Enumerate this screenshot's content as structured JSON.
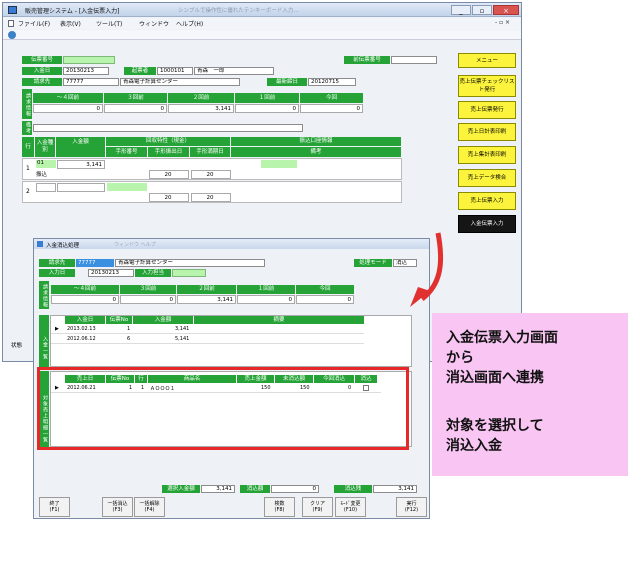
{
  "main_window": {
    "title": "販売管理システム - [入金伝票入力]",
    "blurred_caption": "シンプルで操作性に優れたテンキーボード入力…",
    "menu": [
      "ファイル(F)",
      "表示(V)",
      "ツール(T)",
      "ウィンドウ",
      "ヘルプ(H)"
    ],
    "window_controls": [
      "_",
      "▫",
      "×"
    ],
    "header": {
      "denpyo_no_label": "伝票番号",
      "date_label": "入金日",
      "date_value": "20130213",
      "client_label": "請求先",
      "client_code": "77777",
      "client_name": "青森電子計算センター",
      "creator_label": "起票者",
      "creator_code": "1000101",
      "creator_name": "青森　一郎",
      "last_billing_label": "最新締日",
      "last_billing_value": "20120715",
      "prev_denpyo_label": "前伝票番号"
    },
    "billing_info": {
      "side_label": "請求情報",
      "columns": [
        "～４回前",
        "３回前",
        "２回前",
        "１回前",
        "今回"
      ],
      "values": [
        "0",
        "0",
        "3,141",
        "0",
        "0"
      ]
    },
    "remarks_label": "備考",
    "detail": {
      "headers": {
        "row": "行",
        "type": "入金種別",
        "amount": "入金額",
        "collect": "回収特性（現金）",
        "tegata_no": "手形番号",
        "furidashi": "手形振出日",
        "manki": "手形満期日",
        "bank": "振込口座情報",
        "biko": "備考"
      },
      "rows": [
        {
          "no": "1",
          "type_code": "01",
          "type_name": "振込",
          "amount": "3,141",
          "d1": "20",
          "d2": "20"
        },
        {
          "no": "2",
          "type_code": "",
          "type_name": "",
          "amount": "",
          "d1": "20",
          "d2": "20"
        }
      ]
    },
    "side_buttons": [
      "メニュー",
      "売上伝票チェックリスト発行",
      "売上伝票発行",
      "売上日計表印刷",
      "売上集計表印刷",
      "売上データ検合",
      "売上伝票入力",
      "入金伝票入力"
    ],
    "status_label": "状態"
  },
  "dialog": {
    "title": "入金消込処理",
    "blurred_caption": "ウィンドウ ヘルプ",
    "client_label": "請求先",
    "client_code": "77777",
    "client_name": "青森電子計算センター",
    "mode_label": "処理モード",
    "mode_value": "消込",
    "date_label": "入力日",
    "date_value": "20130213",
    "person_label": "入力担当",
    "billing_info": {
      "side_label": "請求情報",
      "columns": [
        "～４回前",
        "３回前",
        "２回前",
        "１回前",
        "今回"
      ],
      "values": [
        "0",
        "0",
        "3,141",
        "0",
        "0"
      ]
    },
    "nyukin_list": {
      "side_label": "入金一覧",
      "headers": [
        "入金日",
        "伝票No",
        "入金額",
        "摘要"
      ],
      "rows": [
        {
          "date": "2013.02.13",
          "no": "1",
          "amount": "3,141"
        },
        {
          "date": "2012.06.12",
          "no": "6",
          "amount": "5,141"
        }
      ]
    },
    "target_list": {
      "side_label": "対象売上明細一覧",
      "headers": [
        "売上日",
        "伝票No",
        "行",
        "商品名",
        "売上金額",
        "未消込額",
        "今回消込",
        "消込"
      ],
      "rows": [
        {
          "date": "2012.06.21",
          "no": "1",
          "line": "1",
          "item": "ＡＯＯＯ１",
          "sales": "150",
          "remaining": "150",
          "current": "0"
        }
      ]
    },
    "totals": {
      "nyukin_label": "選択入金額",
      "nyukin_value": "3,141",
      "keshikomi_label": "消込額",
      "keshikomi_value": "0",
      "zan_label": "消込残",
      "zan_value": "3,141"
    },
    "fkeys": [
      {
        "label": "終了",
        "key": "(F1)"
      },
      {
        "label": "一括消込",
        "key": "(F3)"
      },
      {
        "label": "一括解除",
        "key": "(F4)"
      },
      {
        "label": "検数",
        "key": "(F8)"
      },
      {
        "label": "クリア",
        "key": "(F9)"
      },
      {
        "label": "ﾓｰﾄﾞ変更",
        "key": "(F10)"
      },
      {
        "label": "実行",
        "key": "(F12)"
      }
    ]
  },
  "annotation": {
    "lines": [
      "入金伝票入力画面",
      "から",
      "消込画面へ連携",
      "",
      "対象を選択して",
      "消込入金"
    ]
  },
  "colors": {
    "header_green": "#25a336",
    "highlight_green": "#b9f4ac",
    "button_yellow": "#fbf33c",
    "note_pink": "#f9c6f4",
    "emphasis_red": "#e62828"
  }
}
